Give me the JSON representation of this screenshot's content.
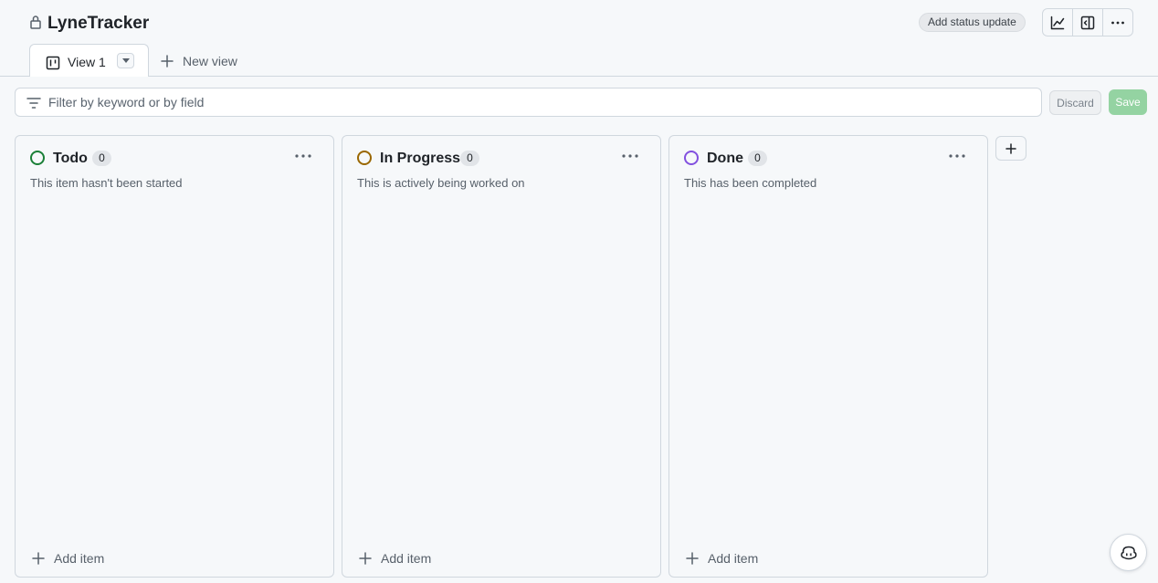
{
  "project": {
    "title": "LyneTracker",
    "add_status_update_label": "Add status update"
  },
  "header_icons": [
    "insights-graph-icon",
    "side-panel-icon",
    "kebab-horizontal-icon"
  ],
  "tabs": {
    "active_view_label": "View 1",
    "new_view_label": "New view"
  },
  "filter": {
    "placeholder": "Filter by keyword or by field",
    "value": "",
    "discard_label": "Discard",
    "save_label": "Save"
  },
  "columns": [
    {
      "title": "Todo",
      "count": "0",
      "description": "This item hasn't been started",
      "status_color": "#1a7f37",
      "add_item_label": "Add item"
    },
    {
      "title": "In Progress",
      "count": "0",
      "description": "This is actively being worked on",
      "status_color": "#9a6700",
      "add_item_label": "Add item"
    },
    {
      "title": "Done",
      "count": "0",
      "description": "This has been completed",
      "status_color": "#8250df",
      "add_item_label": "Add item"
    }
  ],
  "colors": {
    "page_background": "#f6f8fa",
    "border": "#d0d7de",
    "save_button": "#94d3a2"
  }
}
